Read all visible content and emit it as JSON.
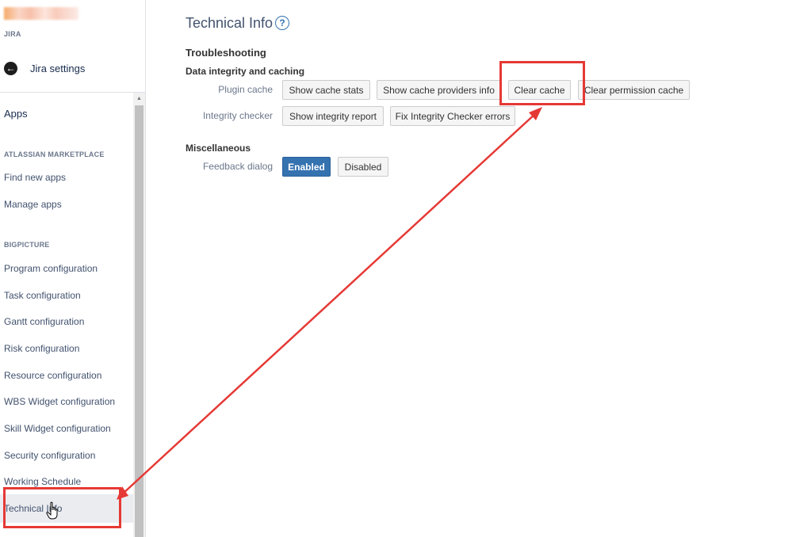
{
  "sidebar": {
    "app_label": "JIRA",
    "back_label": "Jira settings",
    "nav_title": "Apps",
    "sections": [
      {
        "title": "ATLASSIAN MARKETPLACE",
        "items": [
          "Find new apps",
          "Manage apps"
        ]
      },
      {
        "title": "BIGPICTURE",
        "items": [
          "Program configuration",
          "Task configuration",
          "Gantt configuration",
          "Risk configuration",
          "Resource configuration",
          "WBS Widget configuration",
          "Skill Widget configuration",
          "Security configuration",
          "Working Schedule",
          "Technical Info"
        ]
      }
    ],
    "active_item": "Technical Info"
  },
  "main": {
    "title": "Technical Info",
    "help_icon": "?",
    "troubleshooting_heading": "Troubleshooting",
    "data_heading": "Data integrity and caching",
    "plugin_cache": {
      "label": "Plugin cache",
      "buttons": [
        "Show cache stats",
        "Show cache providers info",
        "Clear cache",
        "Clear permission cache"
      ]
    },
    "integrity_checker": {
      "label": "Integrity checker",
      "buttons": [
        "Show integrity report",
        "Fix Integrity Checker errors"
      ]
    },
    "misc_heading": "Miscellaneous",
    "feedback_dialog": {
      "label": "Feedback dialog",
      "buttons": [
        "Enabled",
        "Disabled"
      ],
      "selected": "Enabled"
    }
  },
  "colors": {
    "accent": "#3572b0",
    "annotation": "#e53935"
  }
}
